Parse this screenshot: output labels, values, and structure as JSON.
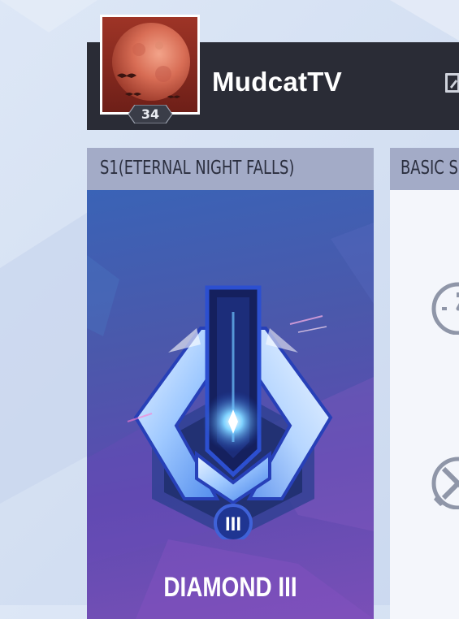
{
  "profile": {
    "name": "MudcatTV",
    "level": "34",
    "avatar_icon": "red-moon-avatar",
    "edit_icon": "edit-icon"
  },
  "season_card": {
    "header": "S1(ETERNAL NIGHT FALLS)",
    "rank_division": "III",
    "rank_name": "DIAMOND III",
    "emblem_icon": "diamond-rank-emblem"
  },
  "stats_card": {
    "header": "BASIC S",
    "icons": [
      "speedometer-icon",
      "swords-icon"
    ]
  },
  "colors": {
    "header_bar": "#2a2c36",
    "card_header": "#a3abc7",
    "card_gradient_top": "#3a63b6",
    "card_gradient_bottom": "#7a4fb7"
  }
}
